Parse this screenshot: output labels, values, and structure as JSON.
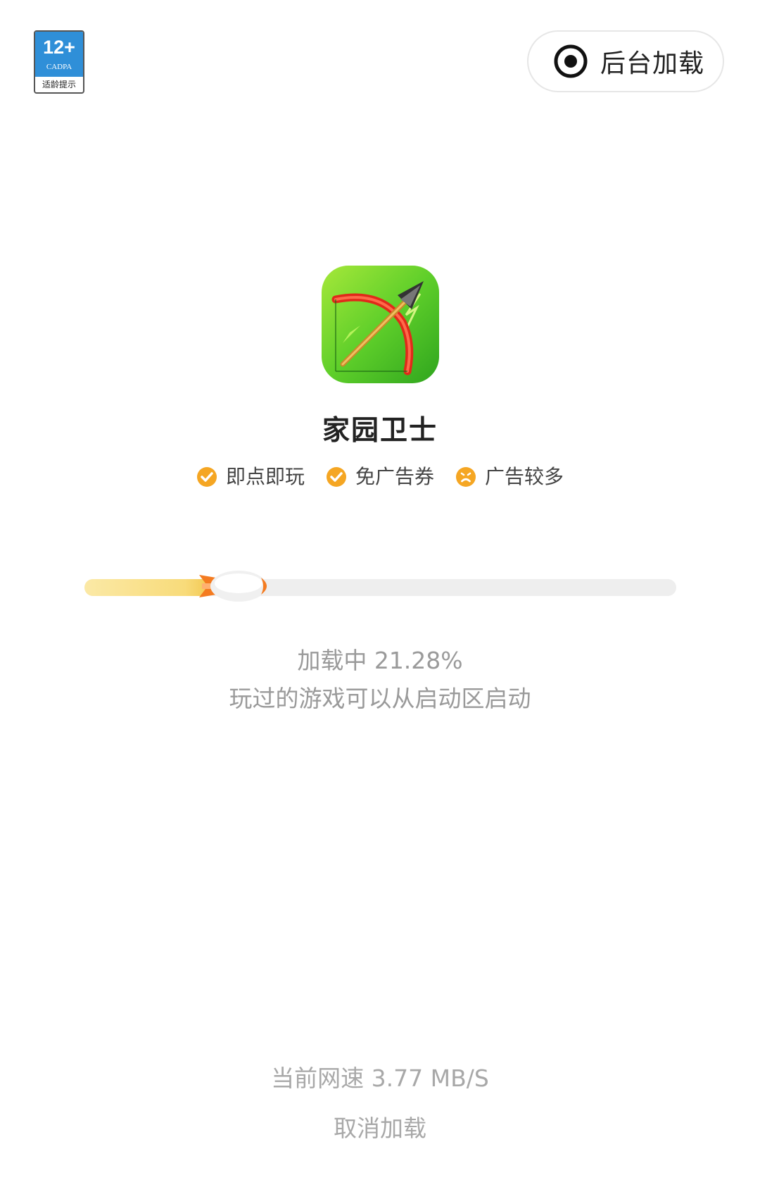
{
  "header": {
    "age_rating": {
      "number": "12+",
      "org": "CADPA",
      "label": "适龄提示"
    },
    "background_load_label": "后台加载"
  },
  "game": {
    "title": "家园卫士",
    "icon": "bow-arrow-game-icon",
    "tags": [
      {
        "label": "即点即玩",
        "icon": "check-circle-icon"
      },
      {
        "label": "免广告券",
        "icon": "check-circle-icon"
      },
      {
        "label": "广告较多",
        "icon": "sad-face-icon"
      }
    ]
  },
  "loading": {
    "progress_percent": 21.28,
    "status_text": "加载中 21.28%",
    "hint_text": "玩过的游戏可以从启动区启动"
  },
  "footer": {
    "speed_text": "当前网速 3.77 MB/S",
    "cancel_label": "取消加载"
  },
  "colors": {
    "accent_orange": "#f5a623",
    "rocket_orange": "#f47b20",
    "progress_fill": "#f8db7a",
    "track": "#eeeeee",
    "muted_text": "#9a9a9a"
  }
}
